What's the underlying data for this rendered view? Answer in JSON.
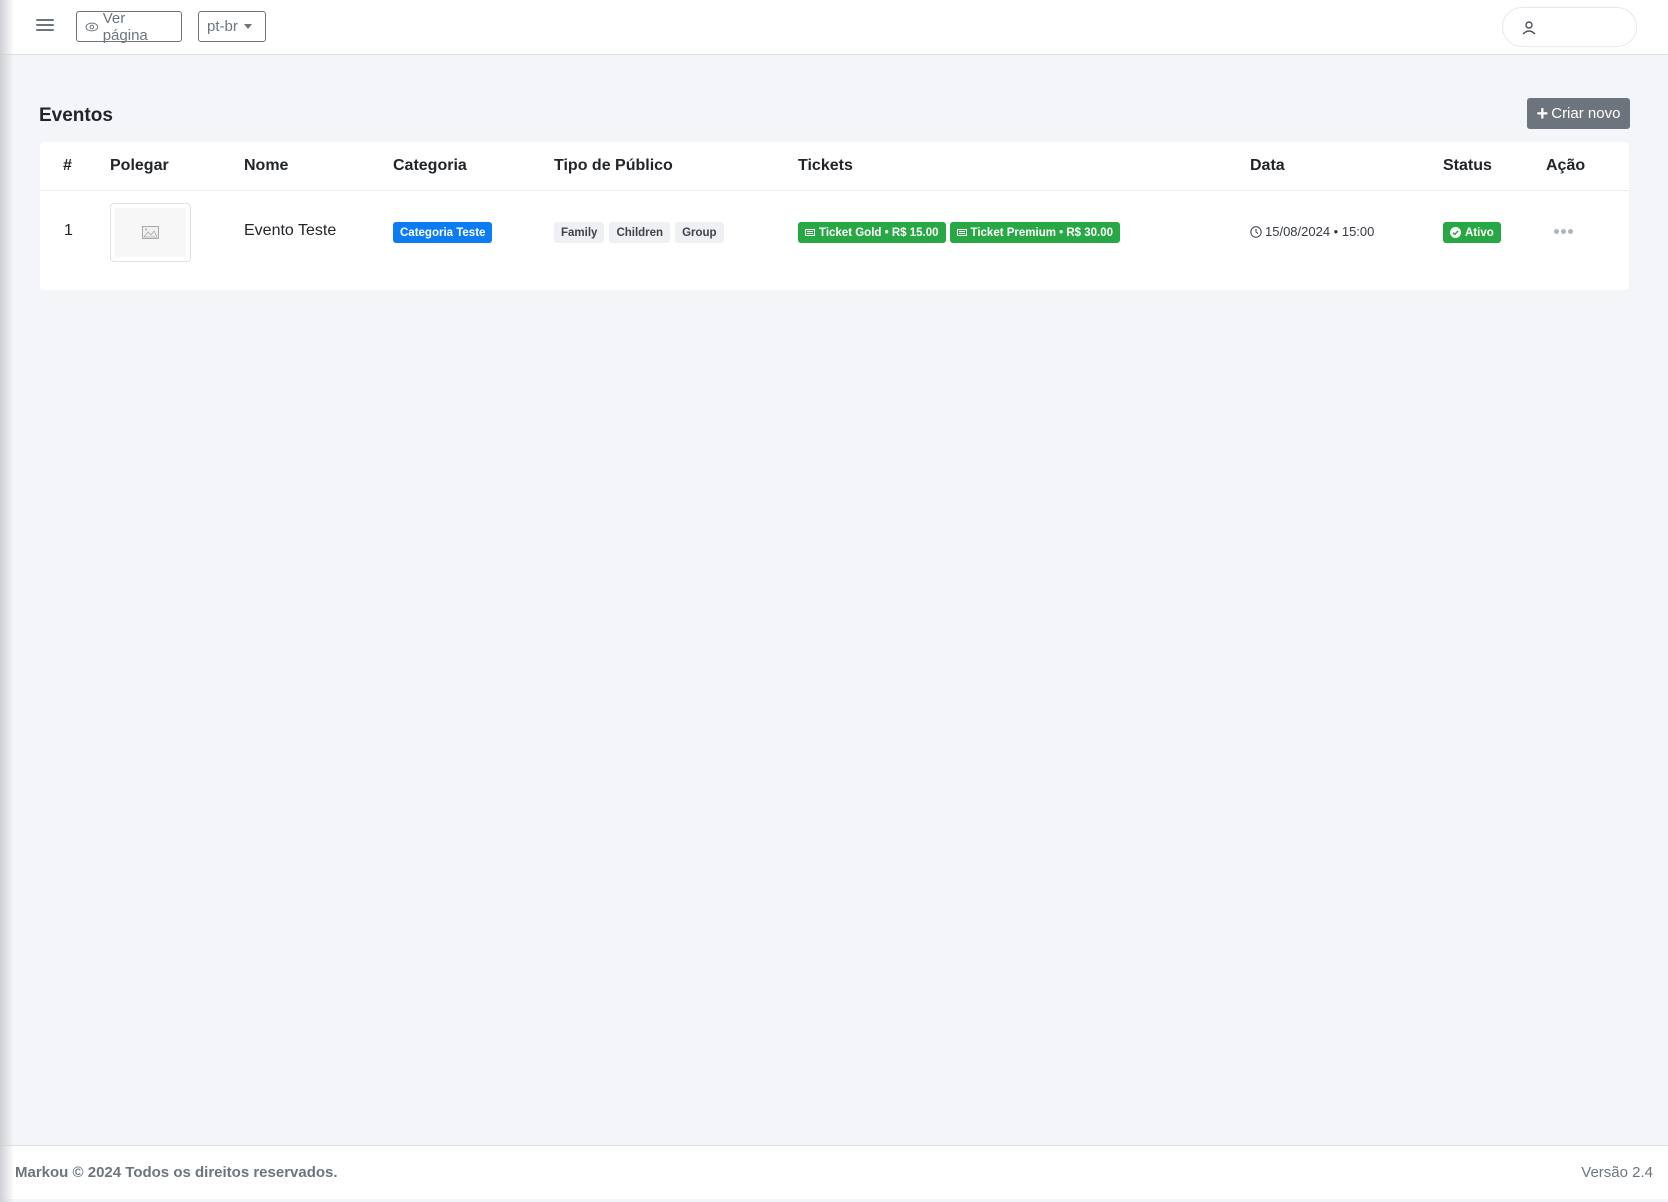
{
  "topbar": {
    "menu_icon": "hamburger-icon",
    "view_page_label": "Ver página",
    "view_page_icon": "eye-icon",
    "language_selected": "pt-br",
    "user_icon": "user-icon"
  },
  "page": {
    "title": "Eventos",
    "create_button_label": "Criar novo",
    "create_button_icon": "plus-icon"
  },
  "table": {
    "columns": [
      "#",
      "Polegar",
      "Nome",
      "Categoria",
      "Tipo de Público",
      "Tickets",
      "Data",
      "Status",
      "Ação"
    ],
    "rows": [
      {
        "index": "1",
        "thumbnail_icon": "image-placeholder-icon",
        "name": "Evento Teste",
        "category": "Categoria Teste",
        "audience": [
          "Family",
          "Children",
          "Group"
        ],
        "tickets": [
          "Ticket Gold • R$ 15.00",
          "Ticket Premium • R$ 30.00"
        ],
        "date": "15/08/2024 • 15:00",
        "status": "Ativo",
        "action_icon": "ellipsis-icon"
      }
    ]
  },
  "colors": {
    "category_badge": "#0d7cf2",
    "ticket_badge": "#28a745",
    "status_badge": "#28a745",
    "create_button": "#6c757d"
  },
  "footer": {
    "copyright": "Markou © 2024 Todos os direitos reservados.",
    "version": "Versão 2.4"
  }
}
